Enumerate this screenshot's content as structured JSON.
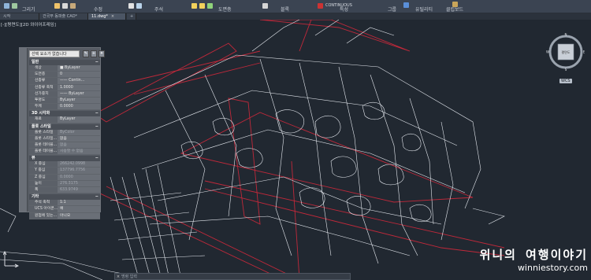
{
  "ribbon": {
    "groups": [
      {
        "label": "그리기"
      },
      {
        "label": "수정"
      },
      {
        "label": "주석"
      },
      {
        "label": "도면층"
      },
      {
        "label": "블록"
      },
      {
        "label": "특성"
      },
      {
        "label": "그룹"
      },
      {
        "label": "유틸리티"
      },
      {
        "label": "클립보드"
      }
    ],
    "layer_value": "CONTINUOUS"
  },
  "tabs": [
    {
      "label": "시작"
    },
    {
      "label": "건국부 동파출 CAD*"
    },
    {
      "label": "11.dwg*"
    }
  ],
  "viewport_label": "[-][평면도][2D 와이어프레임]",
  "viewcube": {
    "face": "평면도",
    "wcs": "WCS",
    "dir_n": "N",
    "dir_s": "S",
    "dir_e": "E",
    "dir_w": "W"
  },
  "properties": {
    "selector": "선택 요소가 없습니다",
    "buttons": [
      "✎",
      "+",
      "✦"
    ],
    "sections": [
      {
        "title": "일반",
        "rows": [
          {
            "k": "색상",
            "v": "■ ByLayer"
          },
          {
            "k": "도면층",
            "v": "0"
          },
          {
            "k": "선종류",
            "v": "—— Contin..."
          },
          {
            "k": "선종류 축척",
            "v": "1.0000"
          },
          {
            "k": "선가중치",
            "v": "—— ByLayer"
          },
          {
            "k": "투명도",
            "v": "ByLayer"
          },
          {
            "k": "두께",
            "v": "0.0000"
          }
        ]
      },
      {
        "title": "3D 시각화",
        "rows": [
          {
            "k": "재료",
            "v": "ByLayer"
          }
        ]
      },
      {
        "title": "플롯 스타일",
        "rows": [
          {
            "k": "플롯 스타일",
            "v": "ByColor",
            "dim": true
          },
          {
            "k": "플롯 스타일...",
            "v": "없음"
          },
          {
            "k": "플롯 테이블...",
            "v": "없음",
            "dim": true
          },
          {
            "k": "플롯 테이블...",
            "v": "사용할 수 없음",
            "dim": true
          }
        ]
      },
      {
        "title": "뷰",
        "rows": [
          {
            "k": "X 중심",
            "v": "266242.0998",
            "dim": true
          },
          {
            "k": "Y 중심",
            "v": "137796.7756",
            "dim": true
          },
          {
            "k": "Z 중심",
            "v": "0.0000",
            "dim": true
          },
          {
            "k": "높이",
            "v": "276.3175",
            "dim": true
          },
          {
            "k": "폭",
            "v": "633.9749",
            "dim": true
          }
        ]
      },
      {
        "title": "기타",
        "rows": [
          {
            "k": "주석 축척",
            "v": "1:1"
          },
          {
            "k": "UCS 아이콘...",
            "v": "예"
          },
          {
            "k": "원점에 있는...",
            "v": "아니오"
          }
        ]
      }
    ]
  },
  "command": {
    "placeholder": "명령 입력"
  },
  "watermark": {
    "line1": "위니의 여행이야기",
    "line2": "winniestory.com"
  },
  "colors": {
    "bg": "#212831",
    "road": "#e6eaf0",
    "boundary": "#c0283a",
    "panel": "#565b63"
  }
}
